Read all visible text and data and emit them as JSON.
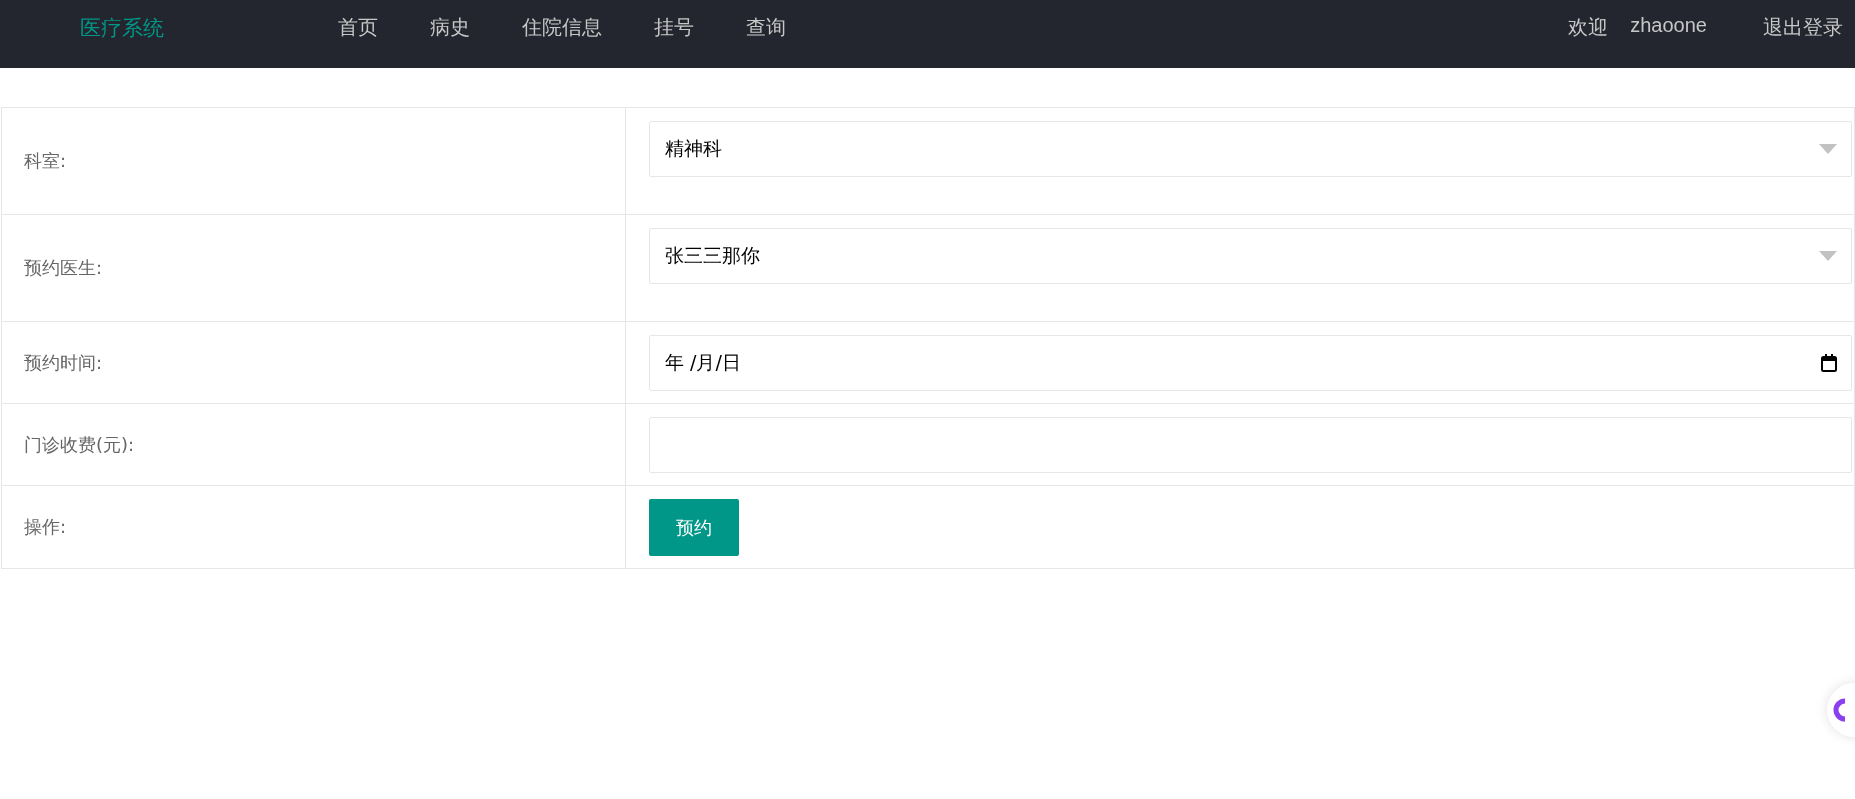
{
  "header": {
    "logo": "医疗系统",
    "nav": [
      {
        "label": "首页"
      },
      {
        "label": "病史"
      },
      {
        "label": "住院信息"
      },
      {
        "label": "挂号"
      },
      {
        "label": "查询"
      }
    ],
    "welcome": "欢迎",
    "username": "zhaoone",
    "logout": "退出登录"
  },
  "form": {
    "rows": [
      {
        "label": "科室:",
        "kind": "select",
        "value": "精神科"
      },
      {
        "label": "预约医生:",
        "kind": "select",
        "value": "张三三那你"
      },
      {
        "label": "预约时间:",
        "kind": "date",
        "value": "年 /月/日"
      },
      {
        "label": "门诊收费(元):",
        "kind": "input"
      },
      {
        "label": "操作:",
        "kind": "button",
        "button": "预约"
      }
    ]
  }
}
